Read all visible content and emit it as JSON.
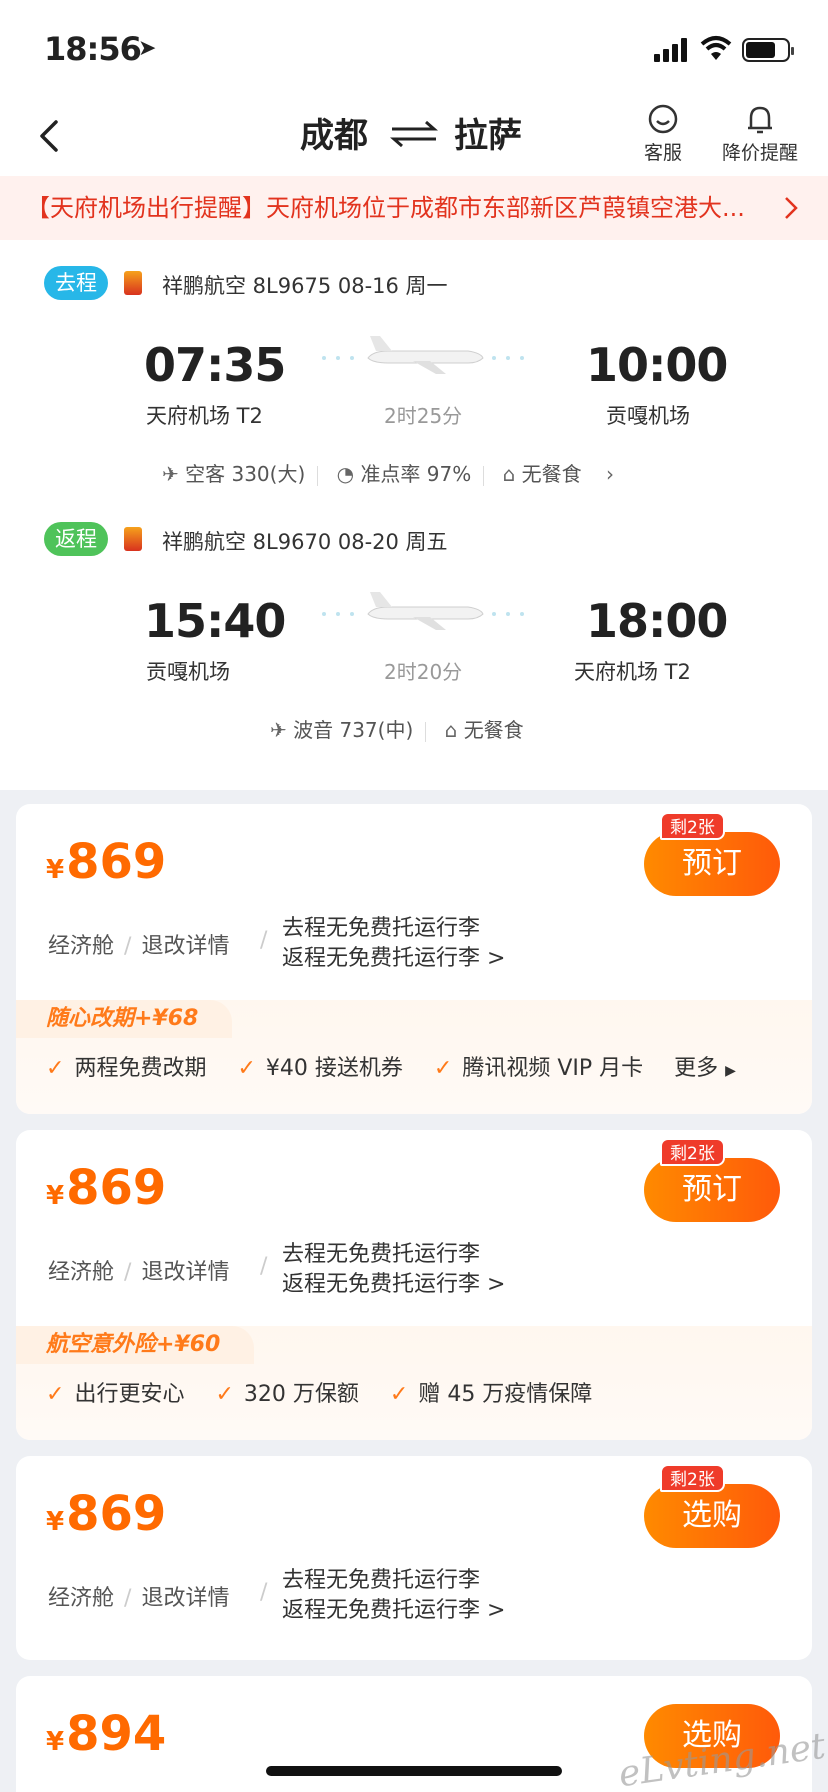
{
  "status": {
    "time": "18:56"
  },
  "nav": {
    "from": "成都",
    "to": "拉萨",
    "service": "客服",
    "price_alert": "降价提醒"
  },
  "notice": {
    "text": "【天府机场出行提醒】天府机场位于成都市东部新区芦葭镇空港大..."
  },
  "outbound": {
    "tag": "去程",
    "info": "祥鹏航空 8L9675 08-16 周一",
    "dep_time": "07:35",
    "dep_airport": "天府机场 T2",
    "duration": "2时25分",
    "arr_time": "10:00",
    "arr_airport": "贡嘎机场",
    "aircraft": "空客 330(大)",
    "ontime": "准点率 97%",
    "meal": "无餐食"
  },
  "inbound": {
    "tag": "返程",
    "info": "祥鹏航空 8L9670 08-20 周五",
    "dep_time": "15:40",
    "dep_airport": "贡嘎机场",
    "duration": "2时20分",
    "arr_time": "18:00",
    "arr_airport": "天府机场 T2",
    "aircraft": "波音 737(中)",
    "meal": "无餐食"
  },
  "offers": [
    {
      "currency": "¥",
      "price": "869",
      "remain": "剩2张",
      "button": "预订",
      "cabin": "经济舱",
      "change": "退改详情",
      "bag1": "去程无免费托运行李",
      "bag2": "返程无免费托运行李 >",
      "extra_title": "随心改期+¥68",
      "perks": [
        "两程免费改期",
        "¥40 接送机券",
        "腾讯视频 VIP 月卡"
      ],
      "more": "更多"
    },
    {
      "currency": "¥",
      "price": "869",
      "remain": "剩2张",
      "button": "预订",
      "cabin": "经济舱",
      "change": "退改详情",
      "bag1": "去程无免费托运行李",
      "bag2": "返程无免费托运行李 >",
      "extra_title": "航空意外险+¥60",
      "perks": [
        "出行更安心",
        "320 万保额",
        "赠 45 万疫情保障"
      ]
    },
    {
      "currency": "¥",
      "price": "869",
      "remain": "剩2张",
      "button": "选购",
      "cabin": "经济舱",
      "change": "退改详情",
      "bag1": "去程无免费托运行李",
      "bag2": "返程无免费托运行李 >"
    },
    {
      "currency": "¥",
      "price": "894",
      "button": "选购"
    }
  ],
  "watermark": "eLvting.net"
}
